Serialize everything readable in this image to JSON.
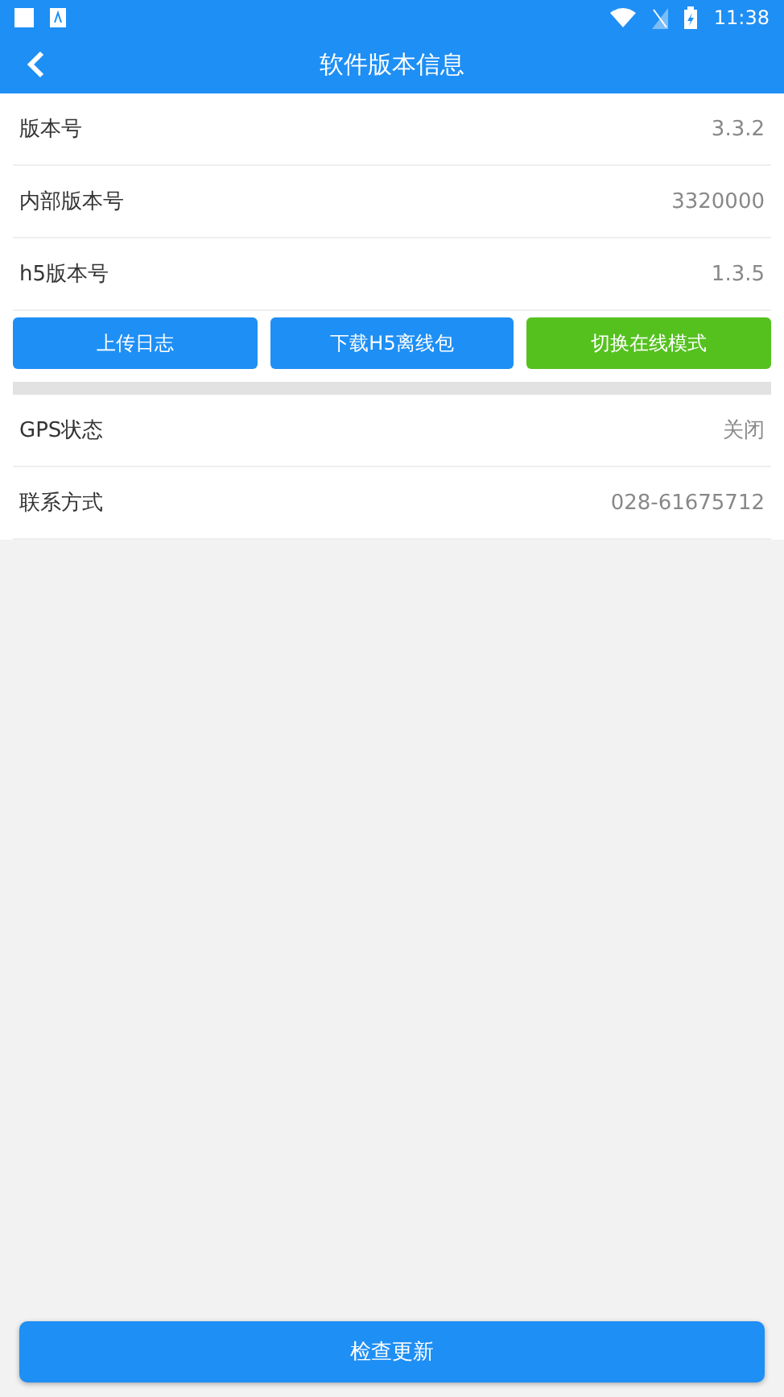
{
  "status_bar": {
    "time": "11:38"
  },
  "header": {
    "title": "软件版本信息"
  },
  "info_rows": [
    {
      "label": "版本号",
      "value": "3.3.2"
    },
    {
      "label": "内部版本号",
      "value": "3320000"
    },
    {
      "label": "h5版本号",
      "value": "1.3.5"
    }
  ],
  "actions": [
    {
      "label": "上传日志",
      "kind": "primary"
    },
    {
      "label": "下载H5离线包",
      "kind": "primary"
    },
    {
      "label": "切换在线模式",
      "kind": "success"
    }
  ],
  "settings_rows": [
    {
      "label": "GPS状态",
      "value": "关闭"
    },
    {
      "label": "联系方式",
      "value": "028-61675712"
    }
  ],
  "footer_button": {
    "label": "检查更新"
  }
}
